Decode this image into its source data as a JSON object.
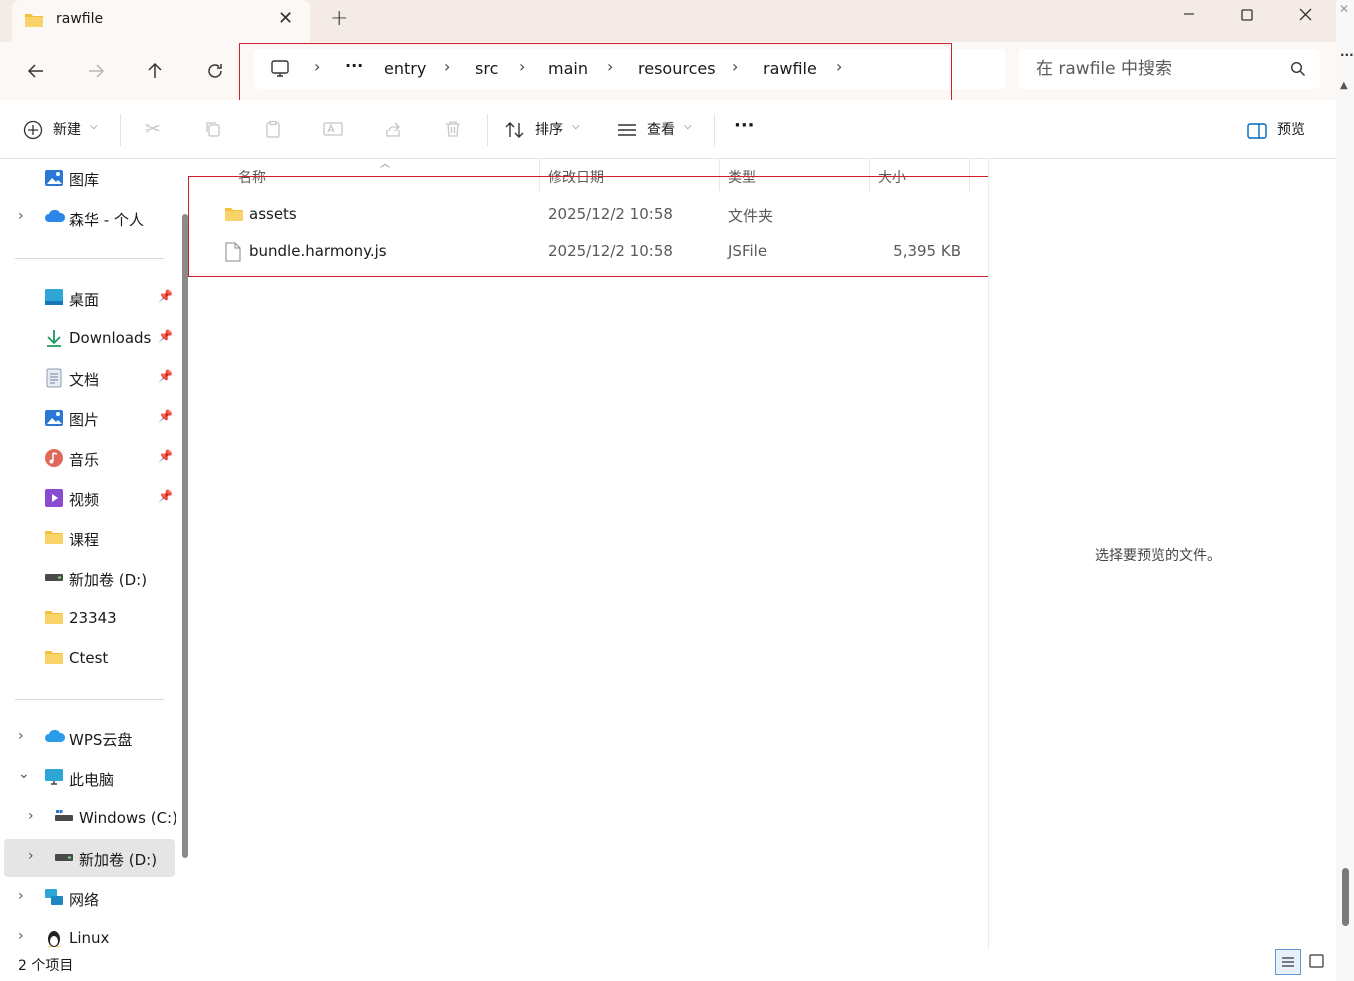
{
  "window": {
    "tab_title": "rawfile",
    "new_tab": "+",
    "close_tab": "✕"
  },
  "nav": {
    "breadcrumbs": [
      "entry",
      "src",
      "main",
      "resources",
      "rawfile"
    ],
    "overflow": "···",
    "search_placeholder": "在 rawfile 中搜索"
  },
  "toolbar": {
    "new_label": "新建",
    "sort_label": "排序",
    "view_label": "查看",
    "more_label": "···",
    "preview_label": "预览"
  },
  "sidebar": {
    "gallery": "图库",
    "onedrive": "森华 - 个人",
    "desktop": "桌面",
    "downloads": "Downloads",
    "documents": "文档",
    "pictures": "图片",
    "music": "音乐",
    "videos": "视频",
    "course": "课程",
    "drive_d_pinned": "新加卷 (D:)",
    "folder_23343": "23343",
    "ctest": "Ctest",
    "wps": "WPS云盘",
    "this_pc": "此电脑",
    "drive_c": "Windows (C:)",
    "drive_d": "新加卷 (D:)",
    "network": "网络",
    "linux": "Linux"
  },
  "columns": {
    "name": "名称",
    "modified": "修改日期",
    "type": "类型",
    "size": "大小"
  },
  "files": [
    {
      "name": "assets",
      "modified": "2025/12/2 10:58",
      "type": "文件夹",
      "size": ""
    },
    {
      "name": "bundle.harmony.js",
      "modified": "2025/12/2 10:58",
      "type": "JSFile",
      "size": "5,395 KB"
    }
  ],
  "preview": {
    "message": "选择要预览的文件。"
  },
  "status": {
    "item_count": "2 个项目"
  },
  "colors": {
    "accent": "#0067c0",
    "highlight_box": "#d11f2a",
    "folder": "#f4c037"
  }
}
